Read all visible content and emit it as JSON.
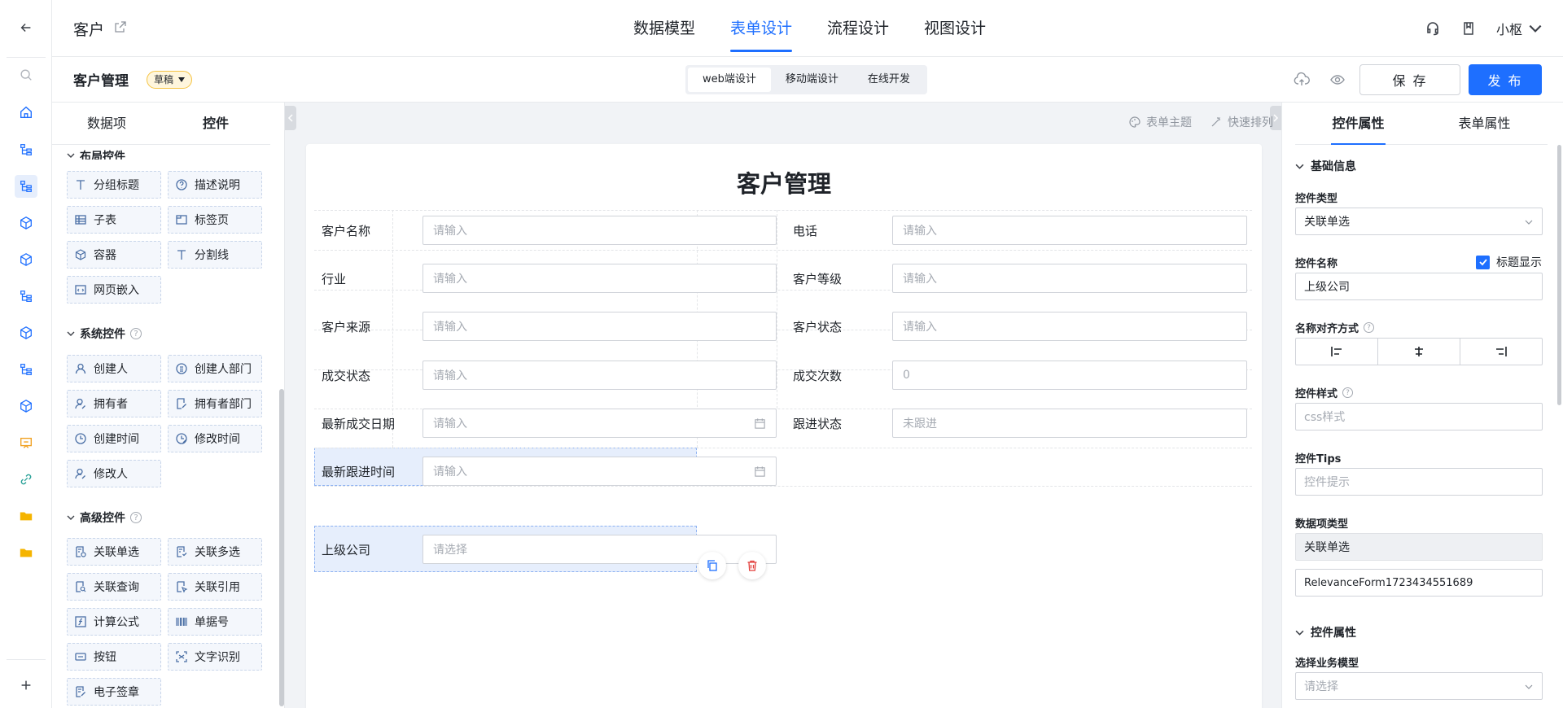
{
  "header": {
    "app_title": "客户",
    "nav_tabs": [
      "数据模型",
      "表单设计",
      "流程设计",
      "视图设计"
    ],
    "active_tab": "表单设计",
    "user_name": "小枢"
  },
  "subbar": {
    "form_name": "客户管理",
    "status_badge": "草稿",
    "design_modes": [
      "web端设计",
      "移动端设计",
      "在线开发"
    ],
    "save_label": "保 存",
    "publish_label": "发 布"
  },
  "left_panel": {
    "tabs": [
      "数据项",
      "控件"
    ],
    "partial_section": "布局控件",
    "layout_controls": [
      "分组标题",
      "描述说明",
      "子表",
      "标签页",
      "容器",
      "分割线",
      "网页嵌入"
    ],
    "system_section": "系统控件",
    "system_controls": [
      "创建人",
      "创建人部门",
      "拥有者",
      "拥有者部门",
      "创建时间",
      "修改时间",
      "修改人"
    ],
    "advanced_section": "高级控件",
    "advanced_controls": [
      "关联单选",
      "关联多选",
      "关联查询",
      "关联引用",
      "计算公式",
      "单据号",
      "按钮",
      "文字识别",
      "电子签章"
    ]
  },
  "canvas": {
    "tool_theme": "表单主题",
    "tool_arrange": "快速排列",
    "form_title": "客户管理",
    "fields": [
      {
        "label": "客户名称",
        "placeholder": "请输入"
      },
      {
        "label": "电话",
        "placeholder": "请输入"
      },
      {
        "label": "行业",
        "placeholder": "请输入"
      },
      {
        "label": "客户等级",
        "placeholder": "请输入"
      },
      {
        "label": "客户来源",
        "placeholder": "请输入"
      },
      {
        "label": "客户状态",
        "placeholder": "请输入"
      },
      {
        "label": "成交状态",
        "placeholder": "请输入"
      },
      {
        "label": "成交次数",
        "placeholder": "0"
      },
      {
        "label": "最新成交日期",
        "placeholder": "请输入"
      },
      {
        "label": "跟进状态",
        "placeholder": "未跟进"
      },
      {
        "label": "最新跟进时间",
        "placeholder": "请输入"
      },
      {
        "label": "上级公司",
        "placeholder": "请选择"
      }
    ]
  },
  "right_panel": {
    "tabs": [
      "控件属性",
      "表单属性"
    ],
    "basic_section": "基础信息",
    "control_type_label": "控件类型",
    "control_type_value": "关联单选",
    "control_name_label": "控件名称",
    "show_title_label": "标题显示",
    "control_name_value": "上级公司",
    "name_align_label": "名称对齐方式",
    "control_style_label": "控件样式",
    "control_style_placeholder": "css样式",
    "control_tips_label": "控件Tips",
    "control_tips_placeholder": "控件提示",
    "data_type_label": "数据项类型",
    "data_type_value": "关联单选",
    "data_code_value": "RelevanceForm1723434551689",
    "control_props_section": "控件属性",
    "business_model_label": "选择业务模型",
    "business_model_placeholder": "请选择"
  },
  "colors": {
    "accent": "#1e6fff",
    "draft_badge": "#fff6dd",
    "selected_cell": "#e6eefc",
    "danger": "#e23c39"
  }
}
